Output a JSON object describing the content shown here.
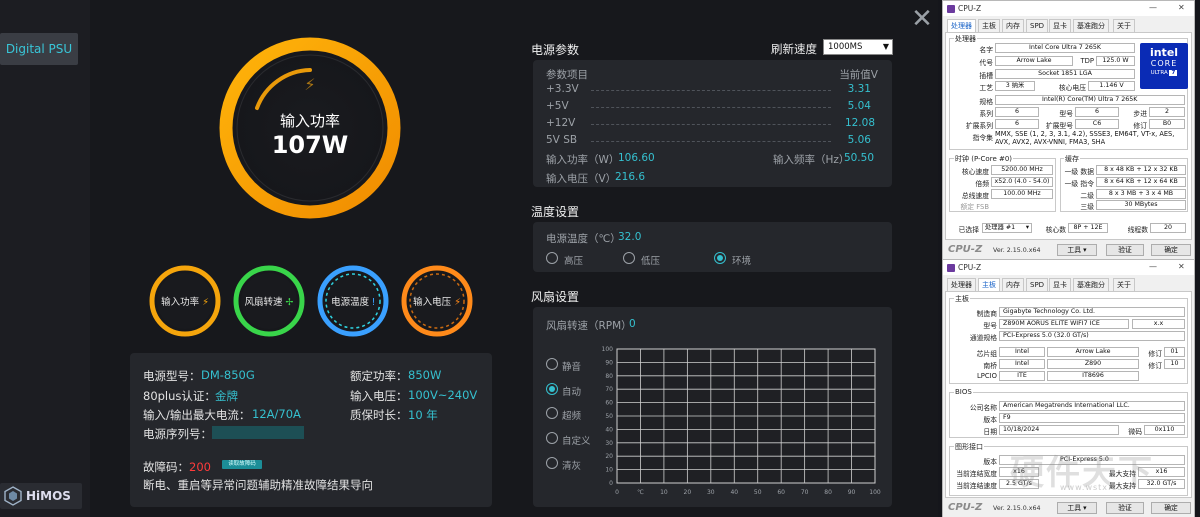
{
  "app": {
    "sidebar_item": "Digital PSU",
    "logo": "HiMOS",
    "close_glyph": "✕"
  },
  "gauge": {
    "label": "输入功率",
    "value": "107W",
    "bolt": "⚡"
  },
  "mini_gauges": [
    {
      "label": "输入功率",
      "icon": "⚡",
      "color": "#f5a50c"
    },
    {
      "label": "风扇转速",
      "icon": "⚡",
      "color": "#39d54a"
    },
    {
      "label": "电源温度",
      "icon": "🌡",
      "color": "#3aa0ff"
    },
    {
      "label": "输入电压",
      "icon": "⚡",
      "color": "#ff8a1a"
    }
  ],
  "info": {
    "model_key": "电源型号：",
    "model": "DM-850G",
    "rated_key": "额定功率：",
    "rated": "850W",
    "plus_key": "80plus认证：",
    "plus": "金牌",
    "voltage_key": "输入电压：",
    "voltage": "100V~240V",
    "current_key": "输入/输出最大电流：",
    "current": "12A/70A",
    "warranty_key": "质保时长：",
    "warranty": "10 年",
    "serial_key": "电源序列号：",
    "fault_key": "故障码：",
    "fault_code": "200",
    "fault_tag": "读取故障码",
    "fault_desc": "断电、重启等异常问题辅助精准故障结果导向"
  },
  "power": {
    "title": "电源参数",
    "refresh_label": "刷新速度",
    "refresh_value": "1000MS",
    "col_item": "参数项目",
    "col_value": "当前值V",
    "rows": [
      {
        "name": "+3.3V",
        "value": "3.31"
      },
      {
        "name": "+5V",
        "value": "5.04"
      },
      {
        "name": "+12V",
        "value": "12.08"
      },
      {
        "name": "5V SB",
        "value": "5.06"
      }
    ],
    "in_power_key": "输入功率（W）",
    "in_power": "106.60",
    "in_freq_key": "输入频率（Hz）",
    "in_freq": "50.50",
    "in_volt_key": "输入电压（V）",
    "in_volt": "216.6"
  },
  "temp": {
    "title": "温度设置",
    "label": "电源温度（℃）",
    "value": "32.0",
    "options": [
      "高压",
      "低压",
      "环境"
    ],
    "selected": "环境"
  },
  "fan": {
    "title": "风扇设置",
    "label": "风扇转速（RPM）",
    "value": "0",
    "modes": [
      "静音",
      "自动",
      "超频",
      "自定义",
      "清灰"
    ],
    "selected": "自动"
  },
  "chart_data": {
    "type": "line",
    "title": "",
    "xlabel": "",
    "ylabel": "",
    "x_ticks": [
      "0",
      "℃",
      "10",
      "20",
      "30",
      "40",
      "50",
      "60",
      "70",
      "80",
      "90",
      "100"
    ],
    "y_ticks": [
      "100",
      "90",
      "80",
      "70",
      "60",
      "50",
      "40",
      "30",
      "20",
      "10",
      "0"
    ],
    "xlim": [
      0,
      100
    ],
    "ylim": [
      0,
      100
    ],
    "grid": true,
    "series": []
  },
  "cpuz1": {
    "title": "CPU-Z",
    "tabs": [
      "处理器",
      "主板",
      "内存",
      "SPD",
      "显卡",
      "基准跑分",
      "关于"
    ],
    "active_tab": "处理器",
    "group_processor": "处理器",
    "name_k": "名字",
    "name": "Intel Core Ultra 7 265K",
    "code_k": "代号",
    "code": "Arrow Lake",
    "tdp_k": "TDP",
    "tdp": "125.0 W",
    "socket_k": "插槽",
    "socket": "Socket 1851 LGA",
    "tech_k": "工艺",
    "tech": "3 纳米",
    "vcore_k": "核心电压",
    "vcore": "1.146 V",
    "spec_k": "规格",
    "spec": "Intel(R) Core(TM) Ultra 7 265K",
    "family_k": "系列",
    "family": "6",
    "model_k": "型号",
    "model": "6",
    "stepping_k": "步进",
    "stepping": "2",
    "extfam_k": "扩展系列",
    "extfam": "6",
    "extmod_k": "扩展型号",
    "extmod": "C6",
    "rev_k": "修订",
    "rev": "B0",
    "instr_k": "指令集",
    "instr": "MMX, SSE (1, 2, 3, 3.1, 4.2), SSSE3, EM64T, VT-x, AES, AVX, AVX2, AVX-VNNI, FMA3, SHA",
    "clock_title": "时钟 (P-Core #0)",
    "core_speed_k": "核心速度",
    "core_speed": "5200.00 MHz",
    "mult_k": "倍频",
    "mult": "x52.0 (4.0 - 54.0)",
    "bus_k": "总线速度",
    "bus": "100.00 MHz",
    "fsb_k": "额定 FSB",
    "cache_title": "缓存",
    "l1d_k": "一级 数据",
    "l1d": "8 x 48 KB + 12 x 32 KB",
    "l1i_k": "一级 指令",
    "l1i": "8 x 64 KB + 12 x 64 KB",
    "l2_k": "二级",
    "l2": "8 x 3 MB + 3 x 4 MB",
    "l3_k": "三级",
    "l3": "30 MBytes",
    "sel_k": "已选择",
    "sel": "处理器 #1",
    "cores_k": "核心数",
    "cores": "8P + 12E",
    "threads_k": "线程数",
    "threads": "20",
    "badge_brand": "intel",
    "badge_core": "CORE",
    "badge_ultra": "ULTRA",
    "badge_num": "7",
    "brand": "CPU-Z",
    "version": "Ver. 2.15.0.x64",
    "tools_btn": "工具",
    "validate_btn": "验证",
    "ok_btn": "确定"
  },
  "cpuz2": {
    "title": "CPU-Z",
    "tabs": [
      "处理器",
      "主板",
      "内存",
      "SPD",
      "显卡",
      "基准跑分",
      "关于"
    ],
    "active_tab": "主板",
    "group_mb": "主板",
    "mfr_k": "制造商",
    "mfr": "Gigabyte Technology Co. Ltd.",
    "model_k": "型号",
    "model": "Z890M AORUS ELITE WIFI7 ICE",
    "model_rev": "x.x",
    "bus_k": "通道规格",
    "bus": "PCI-Express 5.0 (32.0 GT/s)",
    "chipset_k": "芯片组",
    "chipset_v": "Intel",
    "chipset_n": "Arrow Lake",
    "chipset_rev_k": "修订",
    "chipset_rev": "01",
    "south_k": "南桥",
    "south_v": "Intel",
    "south_n": "Z890",
    "south_rev_k": "修订",
    "south_rev": "10",
    "lpcio_k": "LPCIO",
    "lpcio_v": "ITE",
    "lpcio_n": "IT8696",
    "bios_title": "BIOS",
    "brand_k": "公司名称",
    "brand": "American Megatrends International LLC.",
    "ver_k": "版本",
    "ver": "F9",
    "date_k": "日期",
    "date": "10/18/2024",
    "micro_k": "微码",
    "micro": "0x110",
    "gfx_title": "图形接口",
    "gver_k": "版本",
    "gver": "PCI-Express 5.0",
    "gwidth_k": "当前连结宽度",
    "gwidth": "x16",
    "gmaxw_k": "最大支持",
    "gmaxw": "x16",
    "gspeed_k": "当前连结速度",
    "gspeed": "2.5 GT/s",
    "gmaxs_k": "最大支持",
    "gmaxs": "32.0 GT/s",
    "brand_name": "CPU-Z",
    "version": "Ver. 2.15.0.x64",
    "tools_btn": "工具",
    "validate_btn": "验证",
    "ok_btn": "确定"
  },
  "watermark": {
    "text": "硬件天下",
    "url": "www.wstx.com"
  }
}
